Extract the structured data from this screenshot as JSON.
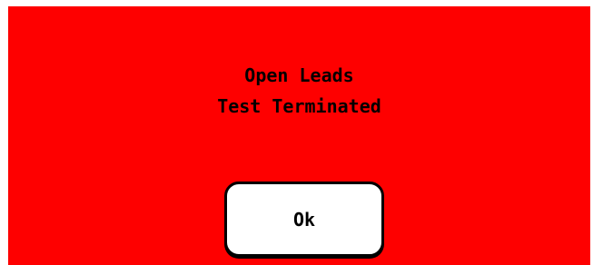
{
  "dialog": {
    "message_line1": "Open Leads",
    "message_line2": "Test Terminated",
    "ok_label": "Ok",
    "background_color": "#fe0000"
  }
}
